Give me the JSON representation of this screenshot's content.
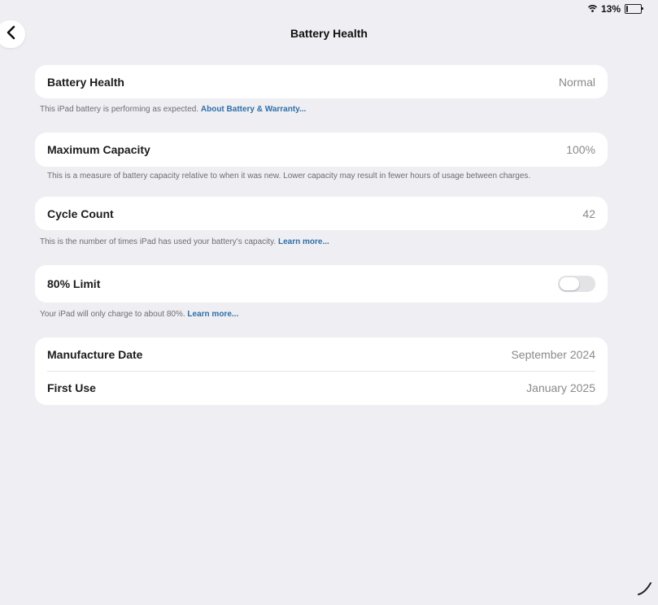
{
  "status_bar": {
    "battery_percent": "13%",
    "battery_level": 0.13,
    "icons": [
      "wifi-icon",
      "battery-icon"
    ]
  },
  "nav": {
    "back_icon": "chevron-left-icon",
    "title": "Battery Health"
  },
  "battery_health": {
    "label": "Battery Health",
    "value": "Normal",
    "footnote": "This iPad battery is performing as expected.",
    "link": "About Battery & Warranty..."
  },
  "maximum_capacity": {
    "label": "Maximum Capacity",
    "value": "100%",
    "footnote": "This is a measure of battery capacity relative to when it was new. Lower capacity may result in fewer hours of usage between charges."
  },
  "cycle_count": {
    "label": "Cycle Count",
    "value": "42",
    "footnote": "This is the number of times iPad has used your battery's capacity.",
    "link": "Learn more..."
  },
  "limit": {
    "label": "80% Limit",
    "enabled": false,
    "footnote": "Your iPad will only charge to about 80%.",
    "link": "Learn more..."
  },
  "dates": {
    "manufacture_label": "Manufacture Date",
    "manufacture_value": "September 2024",
    "first_use_label": "First Use",
    "first_use_value": "January 2025"
  },
  "colors": {
    "background": "#efeff3",
    "card": "#ffffff",
    "link": "#2f6ea8",
    "secondary_text": "#8a8a8e"
  }
}
